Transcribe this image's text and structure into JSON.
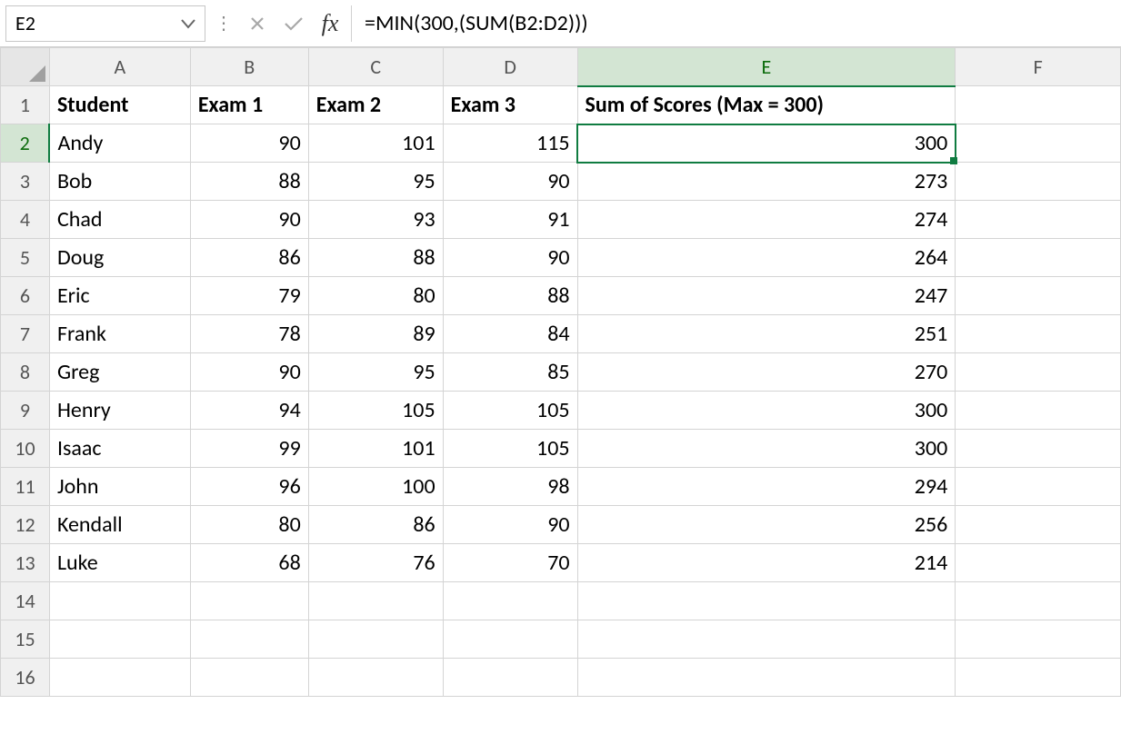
{
  "formula_bar": {
    "name_box": "E2",
    "formula": "=MIN(300,(SUM(B2:D2)))"
  },
  "columns": [
    "A",
    "B",
    "C",
    "D",
    "E",
    "F"
  ],
  "selected_cell": {
    "col": "E",
    "row": 2
  },
  "row_count": 16,
  "headers": {
    "A": "Student",
    "B": "Exam 1",
    "C": "Exam 2",
    "D": "Exam 3",
    "E": "Sum of Scores (Max = 300)"
  },
  "data_rows": [
    {
      "row": 2,
      "A": "Andy",
      "B": 90,
      "C": 101,
      "D": 115,
      "E": 300
    },
    {
      "row": 3,
      "A": "Bob",
      "B": 88,
      "C": 95,
      "D": 90,
      "E": 273
    },
    {
      "row": 4,
      "A": "Chad",
      "B": 90,
      "C": 93,
      "D": 91,
      "E": 274
    },
    {
      "row": 5,
      "A": "Doug",
      "B": 86,
      "C": 88,
      "D": 90,
      "E": 264
    },
    {
      "row": 6,
      "A": "Eric",
      "B": 79,
      "C": 80,
      "D": 88,
      "E": 247
    },
    {
      "row": 7,
      "A": "Frank",
      "B": 78,
      "C": 89,
      "D": 84,
      "E": 251
    },
    {
      "row": 8,
      "A": "Greg",
      "B": 90,
      "C": 95,
      "D": 85,
      "E": 270
    },
    {
      "row": 9,
      "A": "Henry",
      "B": 94,
      "C": 105,
      "D": 105,
      "E": 300
    },
    {
      "row": 10,
      "A": "Isaac",
      "B": 99,
      "C": 101,
      "D": 105,
      "E": 300
    },
    {
      "row": 11,
      "A": "John",
      "B": 96,
      "C": 100,
      "D": 98,
      "E": 294
    },
    {
      "row": 12,
      "A": "Kendall",
      "B": 80,
      "C": 86,
      "D": 90,
      "E": 256
    },
    {
      "row": 13,
      "A": "Luke",
      "B": 68,
      "C": 76,
      "D": 70,
      "E": 214
    }
  ]
}
